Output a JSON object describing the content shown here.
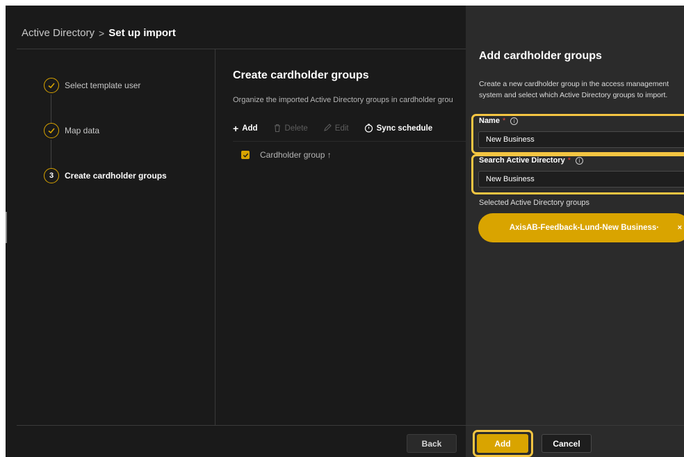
{
  "breadcrumb": {
    "root": "Active Directory",
    "separator": ">",
    "current": "Set up import"
  },
  "steps": [
    {
      "label": "Select template user",
      "state": "done",
      "icon": "check-icon"
    },
    {
      "label": "Map data",
      "state": "done",
      "icon": "check-icon"
    },
    {
      "number": "3",
      "label": "Create cardholder groups",
      "state": "active"
    }
  ],
  "main": {
    "title": "Create cardholder groups",
    "subtitle": "Organize the imported Active Directory groups in cardholder grou",
    "toolbar": {
      "add": {
        "label": "Add",
        "icon": "plus-icon",
        "enabled": true
      },
      "delete": {
        "label": "Delete",
        "icon": "trash-icon",
        "enabled": false
      },
      "edit": {
        "label": "Edit",
        "icon": "pencil-icon",
        "enabled": false
      },
      "sync": {
        "label": "Sync schedule",
        "icon": "clock-icon",
        "enabled": true
      }
    },
    "table": {
      "column": "Cardholder group ↑",
      "select_all_checked": true
    }
  },
  "footer": {
    "back_label": "Back"
  },
  "panel": {
    "title": "Add cardholder groups",
    "description": "Create a new cardholder group in the access management system and select which Active Directory groups to import.",
    "name_field": {
      "label": "Name",
      "required_mark": "*",
      "info_icon": "info-icon",
      "value": "New Business"
    },
    "search_field": {
      "label": "Search Active Directory",
      "required_mark": "*",
      "info_icon": "info-icon",
      "value": "New Business"
    },
    "selected_label": "Selected Active Directory groups",
    "selected_groups": [
      {
        "label": "AxisAB-Feedback-Lund-New Business·",
        "close": "×"
      }
    ],
    "add_label": "Add",
    "cancel_label": "Cancel"
  },
  "colors": {
    "accent": "#d9a400",
    "highlight": "#f4c542",
    "background": "#1a1a1a",
    "panel": "#2b2b2b",
    "required": "#e0483e"
  }
}
